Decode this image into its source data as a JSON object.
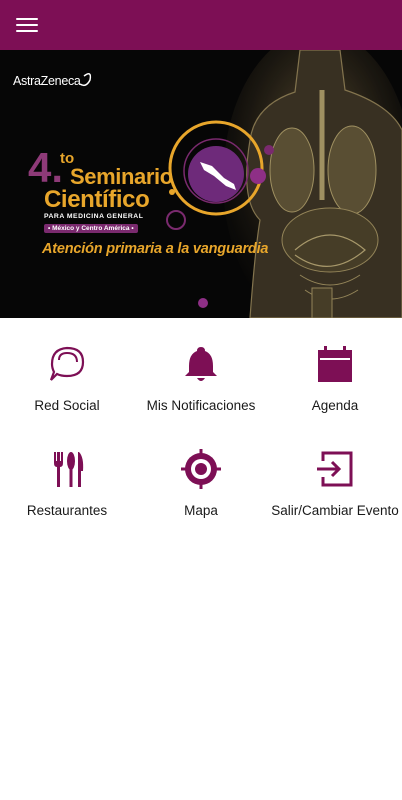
{
  "header": {
    "menu_icon": "hamburger-menu-icon",
    "background_color": "#7d0f55"
  },
  "banner": {
    "brand": "AstraZeneca",
    "event_number": "4.",
    "event_number_suffix": "to",
    "title_line1": "Seminario",
    "title_line2": "Científico",
    "subtitle": "PARA MEDICINA GENERAL",
    "region": "• México y Centro América •",
    "tagline": "Atención primaria a la vanguardia",
    "accent_color": "#e8a62b",
    "purple_color": "#7a2a6e"
  },
  "menu": {
    "icon_color": "#7d0f55",
    "items": [
      {
        "label": "Red Social",
        "icon": "chat-bubbles-icon"
      },
      {
        "label": "Mis Notificaciones",
        "icon": "bell-icon"
      },
      {
        "label": "Agenda",
        "icon": "calendar-icon"
      },
      {
        "label": "Restaurantes",
        "icon": "fork-knife-icon"
      },
      {
        "label": "Mapa",
        "icon": "map-target-icon"
      },
      {
        "label": "Salir/Cambiar Evento",
        "icon": "exit-icon"
      }
    ]
  }
}
